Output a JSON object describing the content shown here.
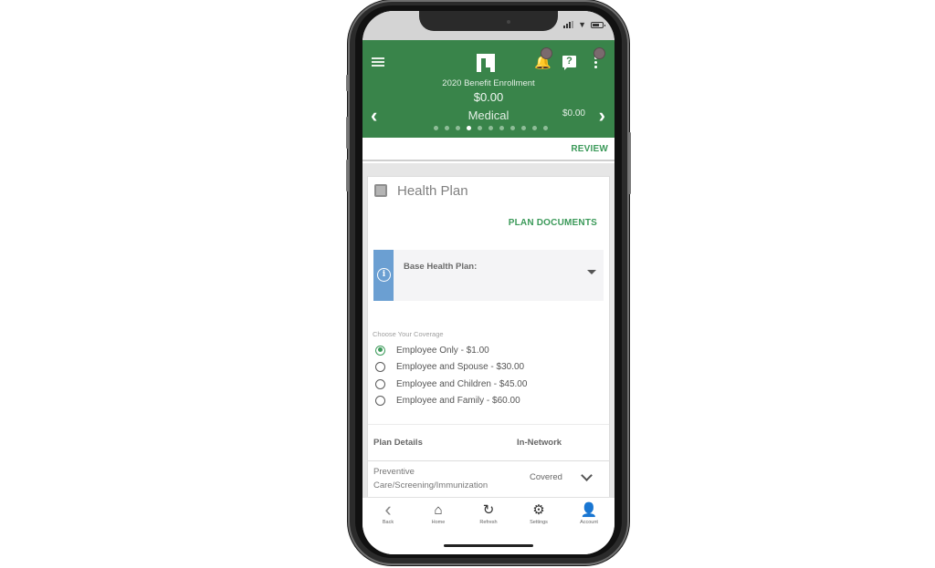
{
  "status_bar": {
    "signal_icon": "cellular-signal-icon",
    "wifi_icon": "wifi-icon",
    "battery_icon": "battery-icon"
  },
  "header": {
    "menu_icon": "hamburger-menu-icon",
    "logo": "paylocity-logo",
    "notifications_icon": "bell-icon",
    "help_icon": "help-question-icon",
    "more_icon": "kebab-menu-icon",
    "enrollment_title": "2020 Benefit Enrollment",
    "total_cost": "$0.00",
    "current_section": "Medical",
    "section_cost": "$0.00",
    "prev_arrow": "‹",
    "next_arrow": "›",
    "steps_total": 11,
    "step_current": 4
  },
  "review_bar": {
    "review_label": "REVIEW"
  },
  "card": {
    "title": "Health Plan",
    "plan_documents_label": "PLAN DOCUMENTS",
    "plan_select": {
      "label": "Base Health Plan:",
      "info_icon": "info-icon",
      "selected_value": ""
    },
    "coverage": {
      "label": "Choose Your Coverage",
      "options": [
        {
          "label": "Employee Only - $1.00",
          "selected": true
        },
        {
          "label": "Employee and Spouse - $30.00",
          "selected": false
        },
        {
          "label": "Employee and Children - $45.00",
          "selected": false
        },
        {
          "label": "Employee and Family - $60.00",
          "selected": false
        }
      ]
    },
    "details": {
      "headers": [
        "Plan Details",
        "In-Network"
      ],
      "rows": [
        {
          "name": "Preventive Care/Screening/Immunization",
          "value": "Covered"
        }
      ]
    }
  },
  "bottom_nav": {
    "items": [
      {
        "label": "Back",
        "icon": "back-chevron-icon",
        "glyph": "‹"
      },
      {
        "label": "Home",
        "icon": "home-icon",
        "glyph": "⌂"
      },
      {
        "label": "Refresh",
        "icon": "refresh-icon",
        "glyph": "↻"
      },
      {
        "label": "Settings",
        "icon": "gear-icon",
        "glyph": "⚙"
      },
      {
        "label": "Account",
        "icon": "account-user-icon",
        "glyph": "👤"
      }
    ]
  }
}
